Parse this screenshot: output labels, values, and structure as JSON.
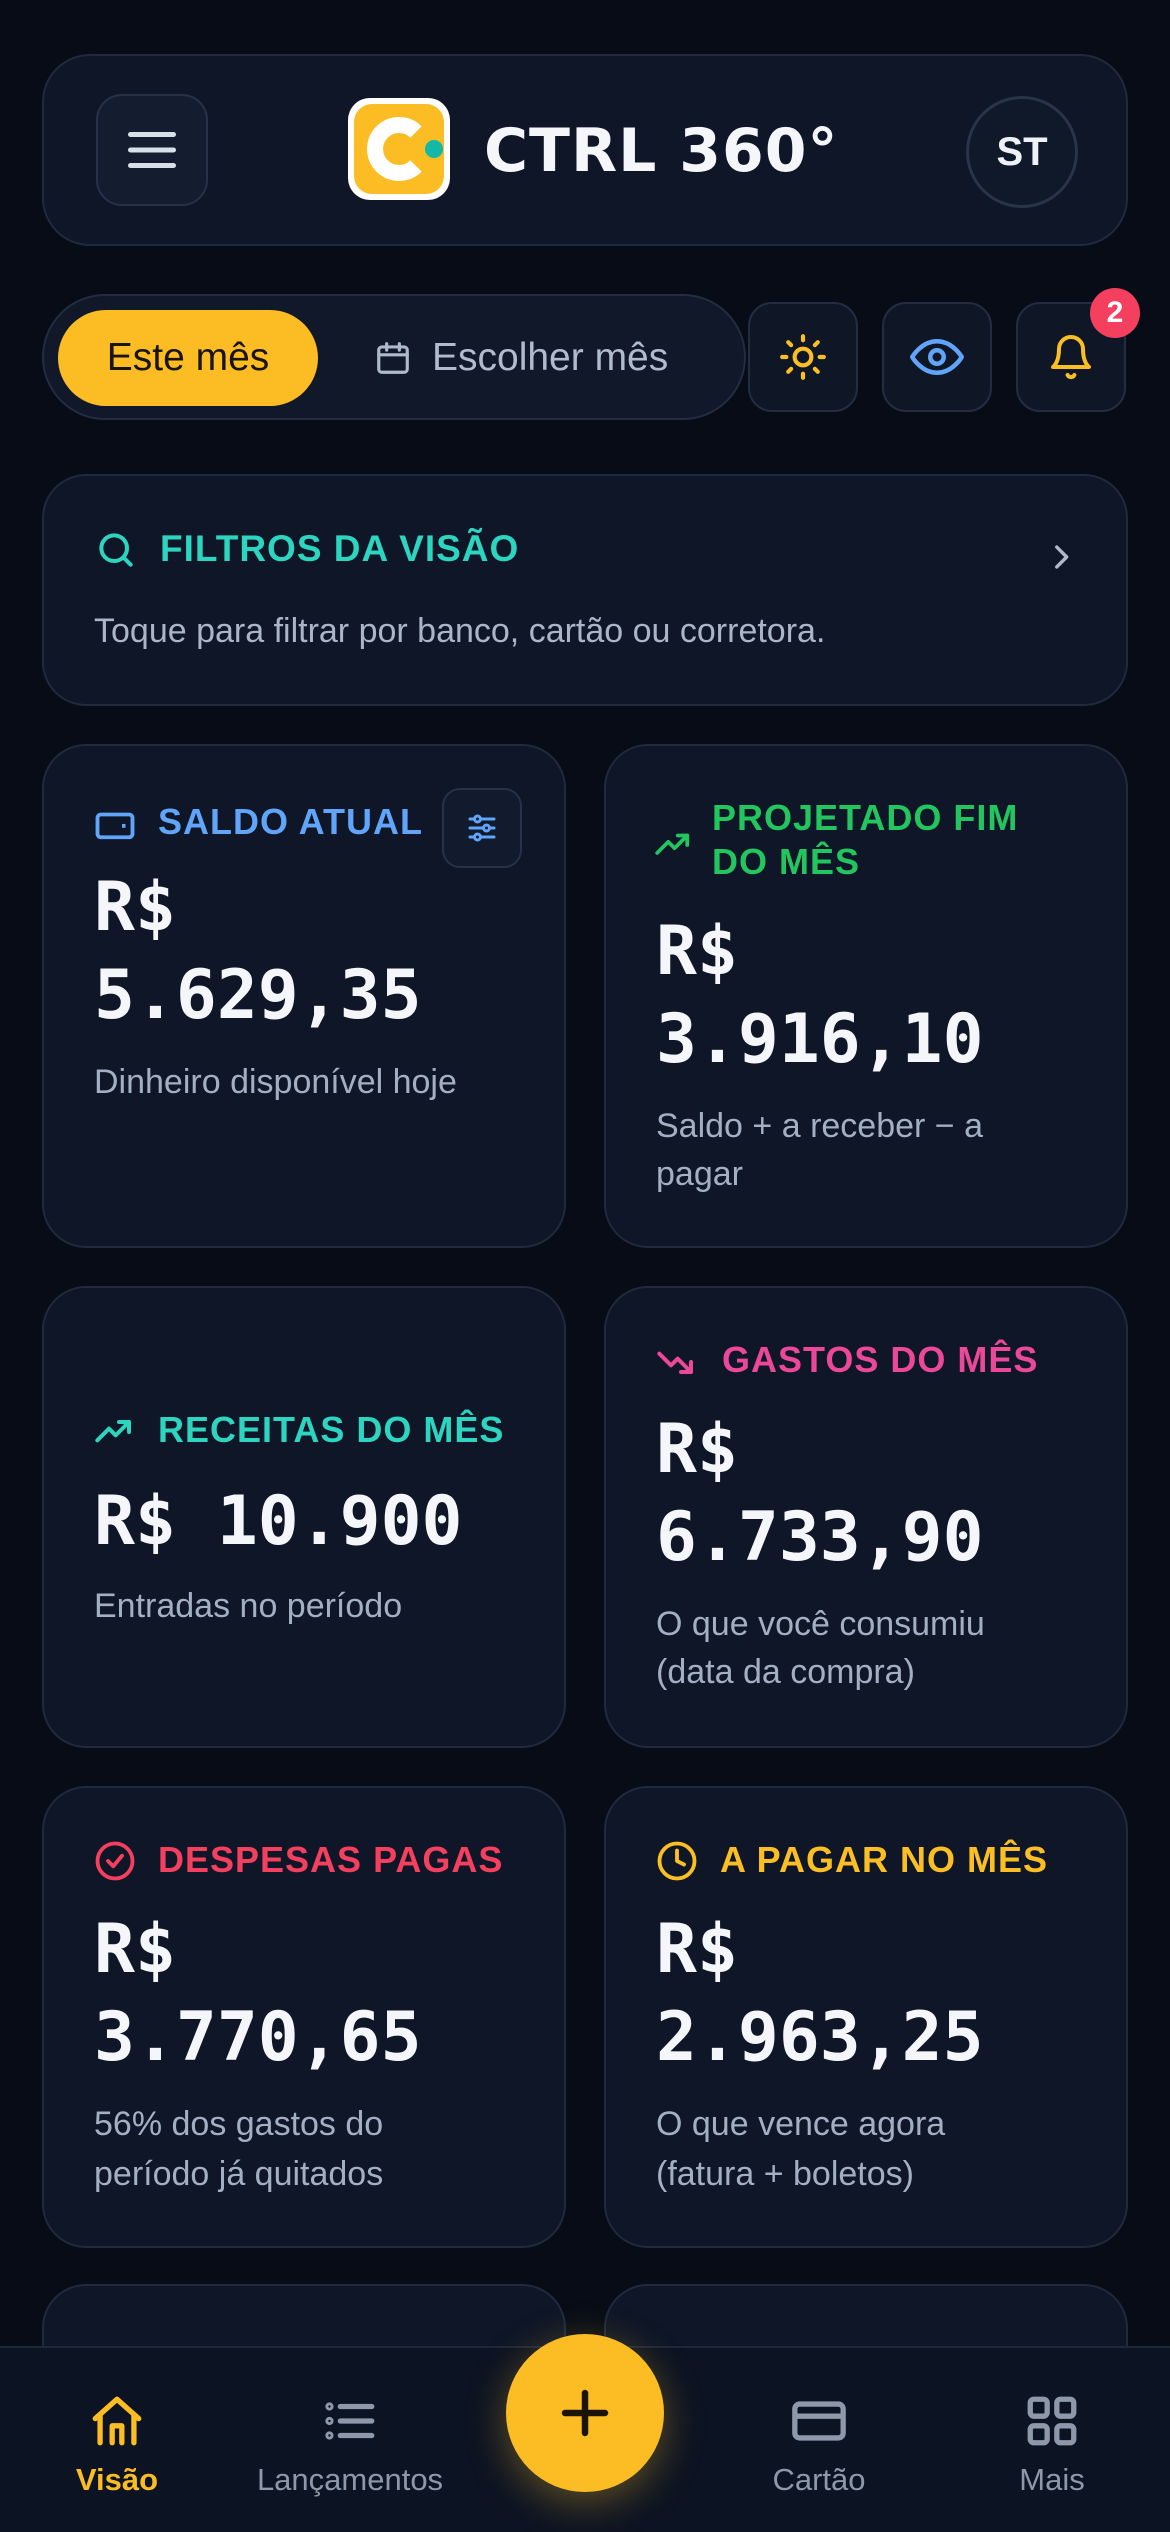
{
  "header": {
    "brand": "CTRL 360°",
    "avatar_initials": "ST"
  },
  "period": {
    "active_label": "Este mês",
    "choose_label": "Escolher mês"
  },
  "notifications": {
    "count": "2"
  },
  "filters": {
    "title": "FILTROS DA VISÃO",
    "description": "Toque para filtrar por banco, cartão ou corretora."
  },
  "metrics": [
    {
      "title_line1": "SALDO ATUAL",
      "value_line1": "R$",
      "value_line2": "5.629,35",
      "desc_line1": "Dinheiro disponível hoje",
      "icon": "wallet-icon",
      "color": "#60a5fa"
    },
    {
      "title_line1": "PROJETADO FIM",
      "title_line2": "DO MÊS",
      "value_line1": "R$",
      "value_line2": "3.916,10",
      "desc_line1": "Saldo + a receber − a",
      "desc_line2": "pagar",
      "icon": "trending-up-icon",
      "color": "#22c55e"
    },
    {
      "title_line1": "RECEITAS DO MÊS",
      "value_line1": "R$ 10.900",
      "desc_line1": "Entradas no período",
      "icon": "trending-up-icon",
      "color": "#2dd4bf"
    },
    {
      "title_line1": "GASTOS DO MÊS",
      "value_line1": "R$",
      "value_line2": "6.733,90",
      "desc_line1": "O que você consumiu",
      "desc_line2": "(data da compra)",
      "icon": "trending-down-icon",
      "color": "#ec4899"
    },
    {
      "title_line1": "DESPESAS PAGAS",
      "value_line1": "R$",
      "value_line2": "3.770,65",
      "desc_line1": "56% dos gastos do",
      "desc_line2": "período já quitados",
      "icon": "check-circle-icon",
      "color": "#f43f5e"
    },
    {
      "title_line1": "A PAGAR NO MÊS",
      "value_line1": "R$",
      "value_line2": "2.963,25",
      "desc_line1": "O que vence agora",
      "desc_line2": "(fatura + boletos)",
      "icon": "clock-icon",
      "color": "#fbbf24"
    }
  ],
  "nav": [
    {
      "label": "Visão",
      "icon": "home-icon",
      "active": true
    },
    {
      "label": "Lançamentos",
      "icon": "list-icon",
      "active": false
    },
    {
      "label": "Cartão",
      "icon": "credit-card-icon",
      "active": false
    },
    {
      "label": "Mais",
      "icon": "grid-icon",
      "active": false
    }
  ],
  "colors": {
    "accent": "#fbbd23",
    "background": "#070c17",
    "card": "#0e1627"
  }
}
